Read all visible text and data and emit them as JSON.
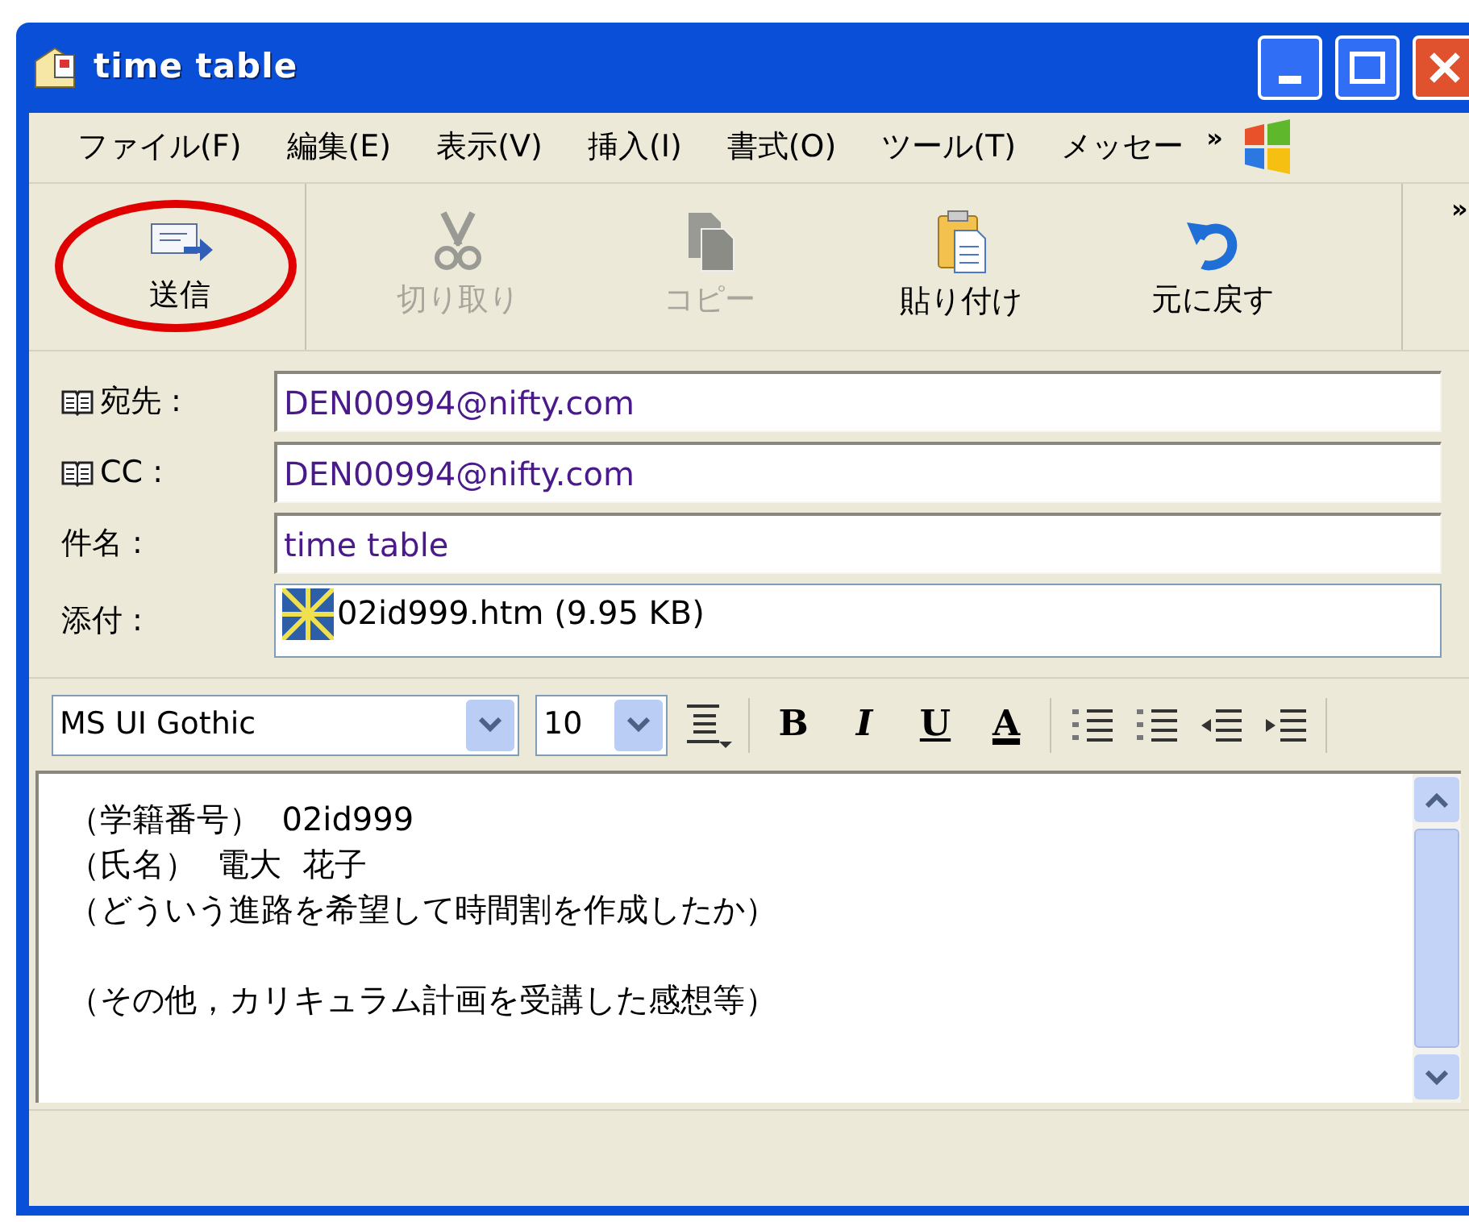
{
  "window": {
    "title": "time table"
  },
  "menu": [
    "ファイル(F)",
    "編集(E)",
    "表示(V)",
    "挿入(I)",
    "書式(O)",
    "ツール(T)",
    "メッセー"
  ],
  "menu_overflow": "»",
  "toolbar_overflow": "»",
  "toolbar": [
    {
      "label": "送信",
      "kind": "send",
      "disabled": false,
      "circled": true
    },
    {
      "label": "切り取り",
      "kind": "cut",
      "disabled": true,
      "circled": false
    },
    {
      "label": "コピー",
      "kind": "copy",
      "disabled": true,
      "circled": false
    },
    {
      "label": "貼り付け",
      "kind": "paste",
      "disabled": false,
      "circled": false
    },
    {
      "label": "元に戻す",
      "kind": "undo",
      "disabled": false,
      "circled": false
    }
  ],
  "fields": [
    {
      "kind": "address",
      "label": "宛先 :",
      "value": "DEN00994@nifty.com"
    },
    {
      "kind": "address",
      "label": "CC :",
      "value": "DEN00994@nifty.com"
    },
    {
      "kind": "text",
      "label": "件名 :",
      "value": "time table"
    },
    {
      "kind": "attachment",
      "label": "添付 :",
      "value": "02id999.htm (9.95 KB)"
    }
  ],
  "format": {
    "font": "MS UI Gothic",
    "size": "10",
    "buttons": [
      "B",
      "I",
      "U",
      "A"
    ]
  },
  "body": {
    "paragraphs": [
      [
        "（学籍番号）  02id999",
        "（氏名）  電大  花子",
        "（どういう進路を希望して時間割を作成したか）"
      ],
      [
        "（その他，カリキュラム計画を受講した感想等）"
      ]
    ]
  }
}
